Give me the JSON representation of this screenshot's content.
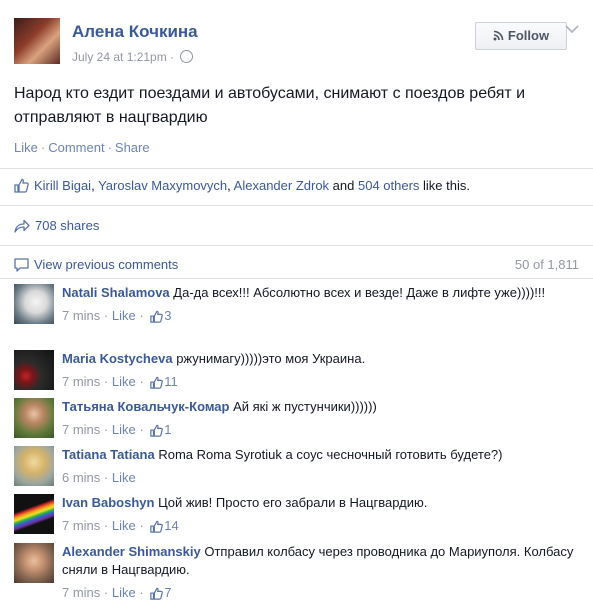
{
  "post": {
    "author": "Алена Кочкина",
    "time": "July 24 at 1:21pm",
    "separator": "·",
    "follow_label": "Follow",
    "message": "Народ кто ездит поездами и автобусами, снимают с поездов ребят и отправляют в нацгвардию",
    "actions": {
      "like": "Like",
      "comment": "Comment",
      "share": "Share",
      "dot": "·"
    }
  },
  "likes": {
    "name1": "Kirill Bigai",
    "sep1": ", ",
    "name2": "Yaroslav Maxymovych",
    "sep2": ", ",
    "name3": "Alexander Zdrok",
    "and": " and ",
    "others": "504 others",
    "tail": " like this."
  },
  "shares": {
    "label": "708 shares"
  },
  "comments_header": {
    "view_previous": "View previous comments",
    "count": "50 of 1,811"
  },
  "comments": [
    {
      "name": "Natali Shalamova",
      "text": "Да-да всех!!! Абсолютно всех и везде! Даже в лифте уже))))!!!",
      "time": "7 mins",
      "like": "Like",
      "likes": "3"
    },
    {
      "name": "Maria Kostycheva",
      "text": "ржунимагу)))))это моя Украина.",
      "time": "7 mins",
      "like": "Like",
      "likes": "11"
    },
    {
      "name": "Татьяна Ковальчук-Комар",
      "text": "Ай які ж пустунчики))))))",
      "time": "7 mins",
      "like": "Like",
      "likes": "1"
    },
    {
      "name": "Tatiana Tatiana",
      "text": "Roma Roma Syrotiuk а соус чесночный готовить будете?)",
      "time": "6 mins",
      "like": "Like",
      "likes": ""
    },
    {
      "name": "Ivan Baboshyn",
      "text": "Цой жив! Просто его забрали в Нацгвардию.",
      "time": "7 mins",
      "like": "Like",
      "likes": "14"
    },
    {
      "name": "Alexander Shimanskiy",
      "text": "Отправил колбасу через проводника до Мариуполя. Колбасу сняли в Нацгвардию.",
      "time": "7 mins",
      "like": "Like",
      "likes": "7"
    }
  ],
  "colors": {
    "link": "#3b5998",
    "meta": "#9197a3",
    "text": "#141823"
  }
}
